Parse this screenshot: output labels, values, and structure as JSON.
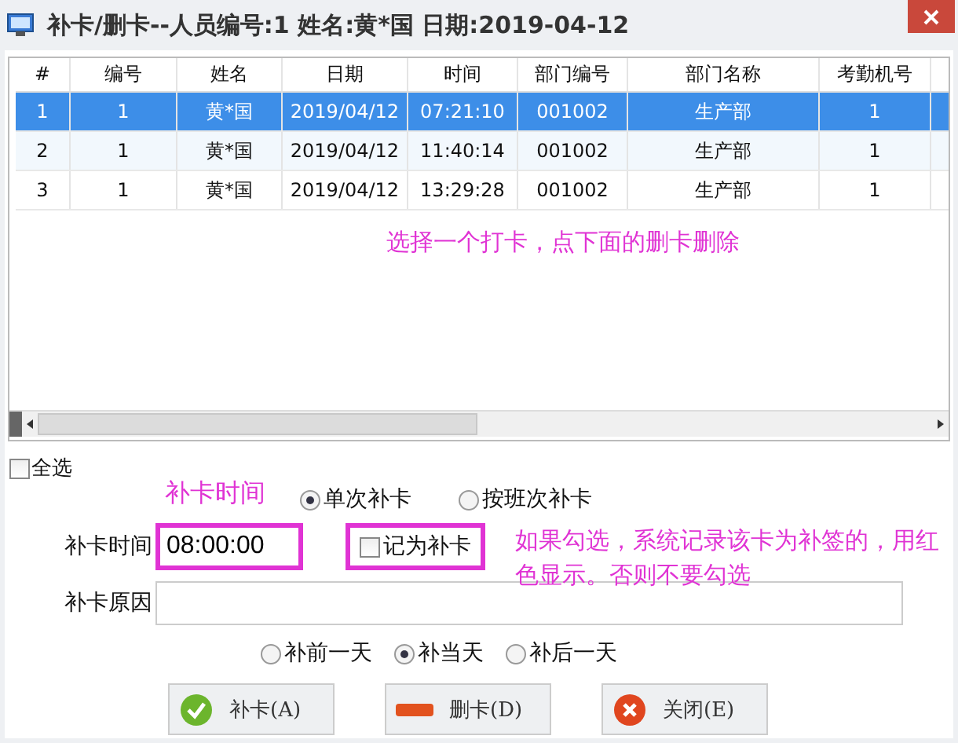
{
  "window": {
    "title": "补卡/删卡--人员编号:1  姓名:黄*国  日期:2019-04-12"
  },
  "table": {
    "columns": [
      "#",
      "编号",
      "姓名",
      "日期",
      "时间",
      "部门编号",
      "部门名称",
      "考勤机号"
    ],
    "rows": [
      {
        "cells": [
          "1",
          "1",
          "黄*国",
          "2019/04/12",
          "07:21:10",
          "001002",
          "生产部",
          "1"
        ],
        "selected": true
      },
      {
        "cells": [
          "2",
          "1",
          "黄*国",
          "2019/04/12",
          "11:40:14",
          "001002",
          "生产部",
          "1"
        ],
        "selected": false
      },
      {
        "cells": [
          "3",
          "1",
          "黄*国",
          "2019/04/12",
          "13:29:28",
          "001002",
          "生产部",
          "1"
        ],
        "selected": false
      }
    ]
  },
  "select_all": {
    "label": "全选",
    "checked": false
  },
  "mode_options": [
    {
      "label": "单次补卡",
      "selected": true
    },
    {
      "label": "按班次补卡",
      "selected": false
    }
  ],
  "time_field": {
    "label": "补卡时间",
    "value": "08:00:00"
  },
  "mark_checkbox": {
    "label": "记为补卡",
    "checked": false
  },
  "reason_field": {
    "label": "补卡原因"
  },
  "day_options": [
    {
      "label": "补前一天",
      "selected": false
    },
    {
      "label": "补当天",
      "selected": true
    },
    {
      "label": "补后一天",
      "selected": false
    }
  ],
  "buttons": [
    {
      "label": "补卡(A)",
      "kind": "add"
    },
    {
      "label": "删卡(D)",
      "kind": "delete"
    },
    {
      "label": "关闭(E)",
      "kind": "close"
    }
  ],
  "annotations": [
    "选择一个打卡，点下面的删卡删除",
    "补卡时间",
    "如果勾选，系统记录该卡为补签的，用红色显示。否则不要勾选"
  ]
}
